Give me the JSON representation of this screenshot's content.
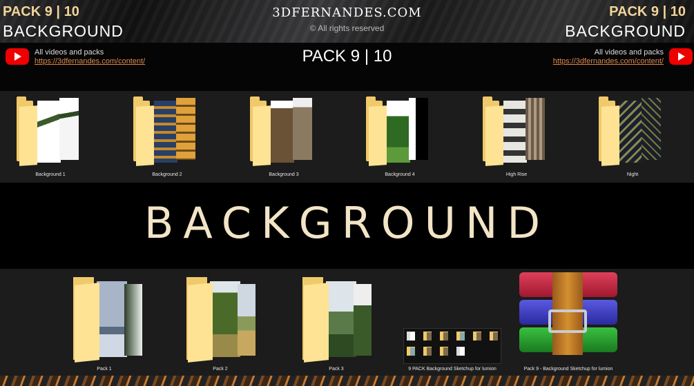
{
  "header": {
    "pack_left": "PACK 9 | 10",
    "bg_left": "BACKGROUND",
    "site": "3DFERNANDES.COM",
    "rights": "© All rights reserved",
    "pack_right": "PACK 9 | 10",
    "bg_right": "BACKGROUND"
  },
  "infobar": {
    "videos_label": "All videos and packs",
    "url": "https://3dfernandes.com/content/",
    "center_title": "PACK 9 | 10"
  },
  "folders_row1": [
    {
      "label": "Background 1"
    },
    {
      "label": "Background 2"
    },
    {
      "label": "Background 3"
    },
    {
      "label": "Background 4"
    },
    {
      "label": "High Rise"
    },
    {
      "label": "Night"
    }
  ],
  "big_title": "BACKGROUND",
  "folders_row2": [
    {
      "label": "Pack 1"
    },
    {
      "label": "Pack 2"
    },
    {
      "label": "Pack 3"
    }
  ],
  "grid_label": "9 PACK  Background Sketchup for lumion",
  "archive_label": "Pack 9 - Background Sketchup for lumion",
  "colors": {
    "accent": "#f2d49a",
    "folder": "#f0c96a",
    "link": "#e0874a",
    "youtube": "#ee0000"
  }
}
